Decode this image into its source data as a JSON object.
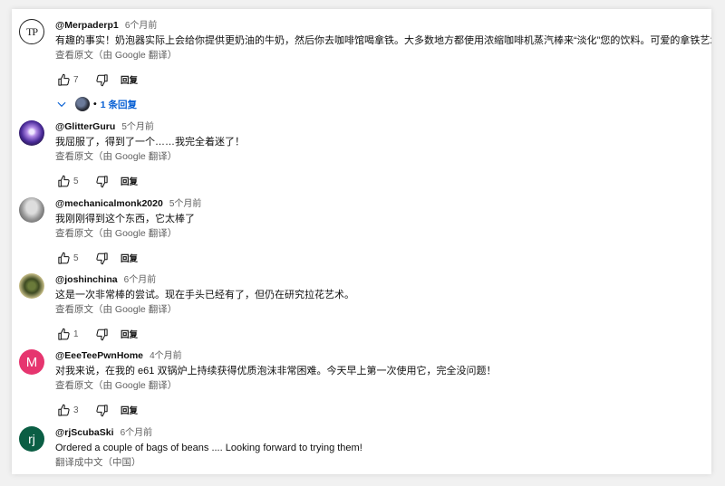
{
  "comments": [
    {
      "handle": "@Merpaderp1",
      "time": "6个月前",
      "text": "有趣的事实！奶泡器实际上会给你提供更奶油的牛奶，然后你去咖啡馆喝拿铁。大多数地方都使用浓缩咖啡机蒸汽棒来“淡化”您的饮料。可爱的拿铁艺术！",
      "translate_label": "查看原文（由 Google 翻译）",
      "likes": "7",
      "reply_label": "回复",
      "avatar_letters": "TP",
      "replies_label": "1 条回复"
    },
    {
      "handle": "@GlitterGuru",
      "time": "5个月前",
      "text": "我屈服了，得到了一个……我完全着迷了！",
      "translate_label": "查看原文（由 Google 翻译）",
      "likes": "5",
      "reply_label": "回复"
    },
    {
      "handle": "@mechanicalmonk2020",
      "time": "5个月前",
      "text": "我刚刚得到这个东西，它太棒了",
      "translate_label": "查看原文（由 Google 翻译）",
      "likes": "5",
      "reply_label": "回复"
    },
    {
      "handle": "@joshinchina",
      "time": "6个月前",
      "text": "这是一次非常棒的尝试。现在手头已经有了，但仍在研究拉花艺术。",
      "translate_label": "查看原文（由 Google 翻译）",
      "likes": "1",
      "reply_label": "回复"
    },
    {
      "handle": "@EeeTeePwnHome",
      "time": "4个月前",
      "text": "对我来说，在我的 e61 双锅炉上持续获得优质泡沫非常困难。今天早上第一次使用它，完全没问题！",
      "translate_label": "查看原文（由 Google 翻译）",
      "likes": "3",
      "reply_label": "回复",
      "avatar_letter": "M",
      "avatar_color": "#e6356f"
    },
    {
      "handle": "@rjScubaSki",
      "time": "6个月前",
      "text": "Ordered a couple of bags of beans .... Looking forward to trying them!",
      "translate_label": "翻译成中文（中国）",
      "avatar_letter": "rj",
      "avatar_color": "#0b5e44"
    }
  ],
  "colors": {
    "link": "#065fd4",
    "muted": "#606060"
  }
}
